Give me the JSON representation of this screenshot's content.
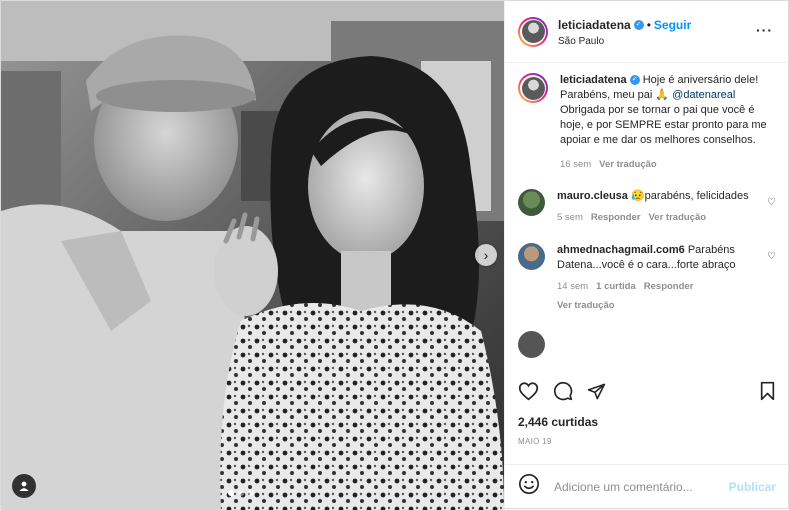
{
  "post": {
    "username": "leticiadatena",
    "follow_label": "Seguir",
    "location": "São Paulo",
    "caption": {
      "username": "leticiadatena",
      "text_before": "Hoje é aniversário dele! Parabéns, meu pai 🙏",
      "mention": "@datenareal",
      "text_after": " Obrigada por se tornar o pai que você é hoje, e por SEMPRE estar pronto para me apoiar e me dar os melhores conselhos.",
      "time": "16 sem",
      "translate": "Ver tradução"
    },
    "comments": [
      {
        "username": "mauro.cleusa",
        "text": "😥parabéns, felicidades",
        "time": "5 sem",
        "reply": "Responder",
        "translate": "Ver tradução"
      },
      {
        "username": "ahmednachagmail.com6",
        "text": " Parabéns Datena...você é o cara...forte abraço",
        "time": "14 sem",
        "likes": "1 curtida",
        "reply": "Responder",
        "translate": "Ver tradução"
      }
    ],
    "likes_count": "2,446 curtidas",
    "date": "MAIO 19",
    "comment_placeholder": "Adicione um comentário...",
    "publish_label": "Publicar"
  },
  "carousel": {
    "total": 3,
    "active": 1
  },
  "colors": {
    "accent": "#0095f6",
    "publish_disabled": "#b2dffc",
    "muted": "#8e8e8e"
  }
}
